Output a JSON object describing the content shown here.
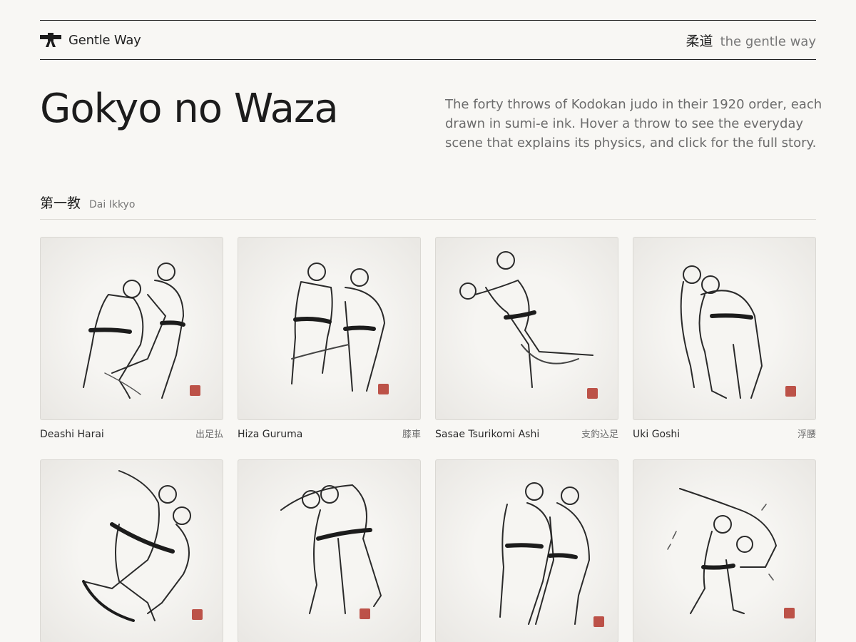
{
  "brand": {
    "name": "Gentle Way",
    "icon": "judo-belt-icon"
  },
  "tagline": {
    "jp": "柔道",
    "en": "the gentle way"
  },
  "hero": {
    "title": "Gokyo no Waza",
    "intro": "The forty throws of Kodokan judo in their 1920 order, each drawn in sumi-e ink. Hover a throw to see the everyday scene that explains its physics, and click for the full story."
  },
  "section": {
    "jp": "第一教",
    "en": "Dai Ikkyo"
  },
  "throws": [
    {
      "name": "Deashi Harai",
      "kanji": "出足払"
    },
    {
      "name": "Hiza Guruma",
      "kanji": "膝車"
    },
    {
      "name": "Sasae Tsurikomi Ashi",
      "kanji": "支釣込足"
    },
    {
      "name": "Uki Goshi",
      "kanji": "浮腰"
    },
    {
      "name": "",
      "kanji": ""
    },
    {
      "name": "",
      "kanji": ""
    },
    {
      "name": "",
      "kanji": ""
    },
    {
      "name": "",
      "kanji": ""
    }
  ],
  "colors": {
    "background": "#f8f7f4",
    "ink": "#1c1c1c",
    "seal": "#b3362b",
    "muted": "#6b6b6b"
  }
}
